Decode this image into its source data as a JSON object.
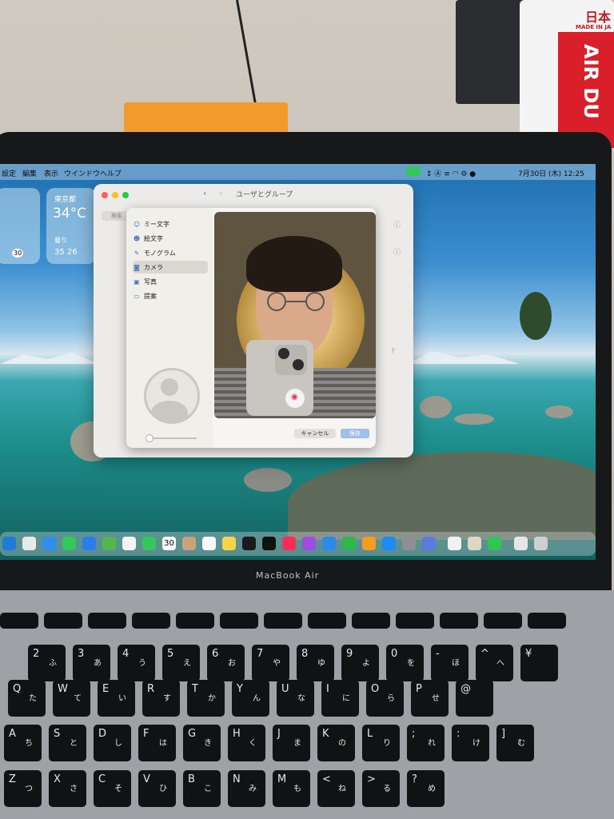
{
  "menubar": {
    "items": [
      "設定",
      "編集",
      "表示",
      "ウインドウ",
      "ヘルプ"
    ],
    "datetime": "7月30日 (木)  12:25"
  },
  "widgets": {
    "city": "東京都",
    "temperature": "34°C",
    "condition": "曇り",
    "hi_lo": "35 26",
    "calendar_day": "30"
  },
  "window": {
    "title": "ユーザとグループ",
    "search_placeholder": "検索"
  },
  "sheet": {
    "nav": [
      {
        "label": "ミー文字",
        "icon": "memoji-icon"
      },
      {
        "label": "絵文字",
        "icon": "emoji-icon"
      },
      {
        "label": "モノグラム",
        "icon": "pencil-icon"
      },
      {
        "label": "カメラ",
        "icon": "camera-icon"
      },
      {
        "label": "写真",
        "icon": "photos-icon"
      },
      {
        "label": "提案",
        "icon": "folder-icon"
      }
    ],
    "selected": "カメラ",
    "cancel_label": "キャンセル",
    "save_label": "保存"
  },
  "dock": {
    "calendar_date": "30"
  },
  "laptop": {
    "brand": "MacBook Air"
  },
  "spray_can": {
    "line1": "日本",
    "line2": "MADE IN JA",
    "line3": "AIR DU"
  },
  "keyboard": {
    "row_numbers": [
      {
        "top": "2",
        "kana": "ふ"
      },
      {
        "top": "3",
        "kana": "あ"
      },
      {
        "top": "4",
        "kana": "う"
      },
      {
        "top": "5",
        "kana": "え"
      },
      {
        "top": "6",
        "kana": "お"
      },
      {
        "top": "7",
        "kana": "や"
      },
      {
        "top": "8",
        "kana": "ゆ"
      },
      {
        "top": "9",
        "kana": "よ"
      },
      {
        "top": "0",
        "kana": "を"
      },
      {
        "top": "-",
        "kana": "ほ"
      },
      {
        "top": "^",
        "kana": "へ"
      },
      {
        "top": "¥",
        "kana": ""
      }
    ],
    "row_q": [
      {
        "top": "Q",
        "kana": "た"
      },
      {
        "top": "W",
        "kana": "て"
      },
      {
        "top": "E",
        "kana": "い"
      },
      {
        "top": "R",
        "kana": "す"
      },
      {
        "top": "T",
        "kana": "か"
      },
      {
        "top": "Y",
        "kana": "ん"
      },
      {
        "top": "U",
        "kana": "な"
      },
      {
        "top": "I",
        "kana": "に"
      },
      {
        "top": "O",
        "kana": "ら"
      },
      {
        "top": "P",
        "kana": "せ"
      },
      {
        "top": "@",
        "kana": ""
      }
    ],
    "row_a": [
      {
        "top": "A",
        "kana": "ち"
      },
      {
        "top": "S",
        "kana": "と"
      },
      {
        "top": "D",
        "kana": "し"
      },
      {
        "top": "F",
        "kana": "は"
      },
      {
        "top": "G",
        "kana": "き"
      },
      {
        "top": "H",
        "kana": "く"
      },
      {
        "top": "J",
        "kana": "ま"
      },
      {
        "top": "K",
        "kana": "の"
      },
      {
        "top": "L",
        "kana": "り"
      },
      {
        "top": ";",
        "kana": "れ"
      },
      {
        "top": ":",
        "kana": "け"
      },
      {
        "top": "]",
        "kana": "む"
      }
    ],
    "row_z": [
      {
        "top": "Z",
        "kana": "つ"
      },
      {
        "top": "X",
        "kana": "さ"
      },
      {
        "top": "C",
        "kana": "そ"
      },
      {
        "top": "V",
        "kana": "ひ"
      },
      {
        "top": "B",
        "kana": "こ"
      },
      {
        "top": "N",
        "kana": "み"
      },
      {
        "top": "M",
        "kana": "も"
      },
      {
        "top": "<",
        "kana": "ね"
      },
      {
        "top": ">",
        "kana": "る"
      },
      {
        "top": "?",
        "kana": "め"
      }
    ]
  }
}
